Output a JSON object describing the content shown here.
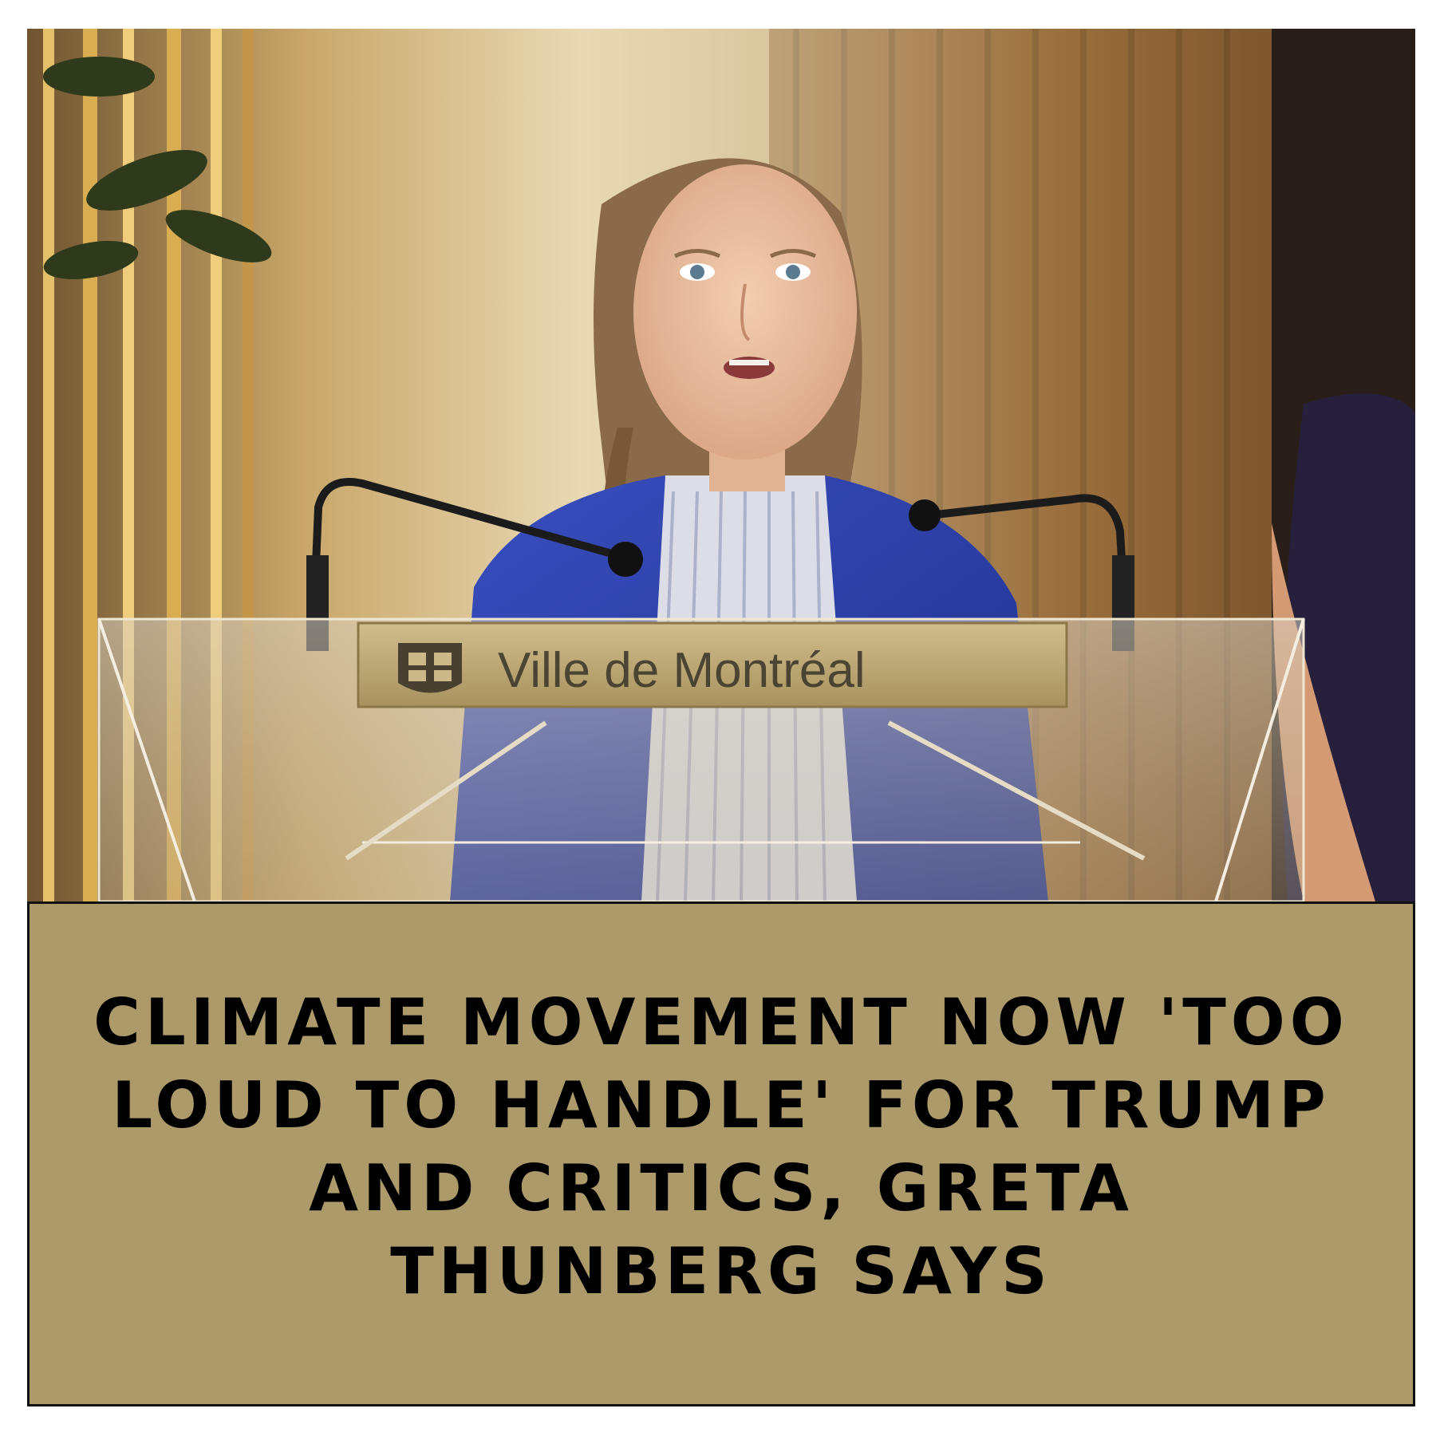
{
  "photo": {
    "podium_sign_text": "Ville de Montréal",
    "description_icon": "photo-of-speaker-at-podium"
  },
  "caption": {
    "headline": "CLIMATE MOVEMENT NOW 'TOO LOUD TO HANDLE' FOR TRUMP AND CRITICS, GRETA THUNBERG SAYS"
  },
  "colors": {
    "caption_background": "#ad9a6b",
    "caption_border": "#111111",
    "text": "#000000"
  }
}
